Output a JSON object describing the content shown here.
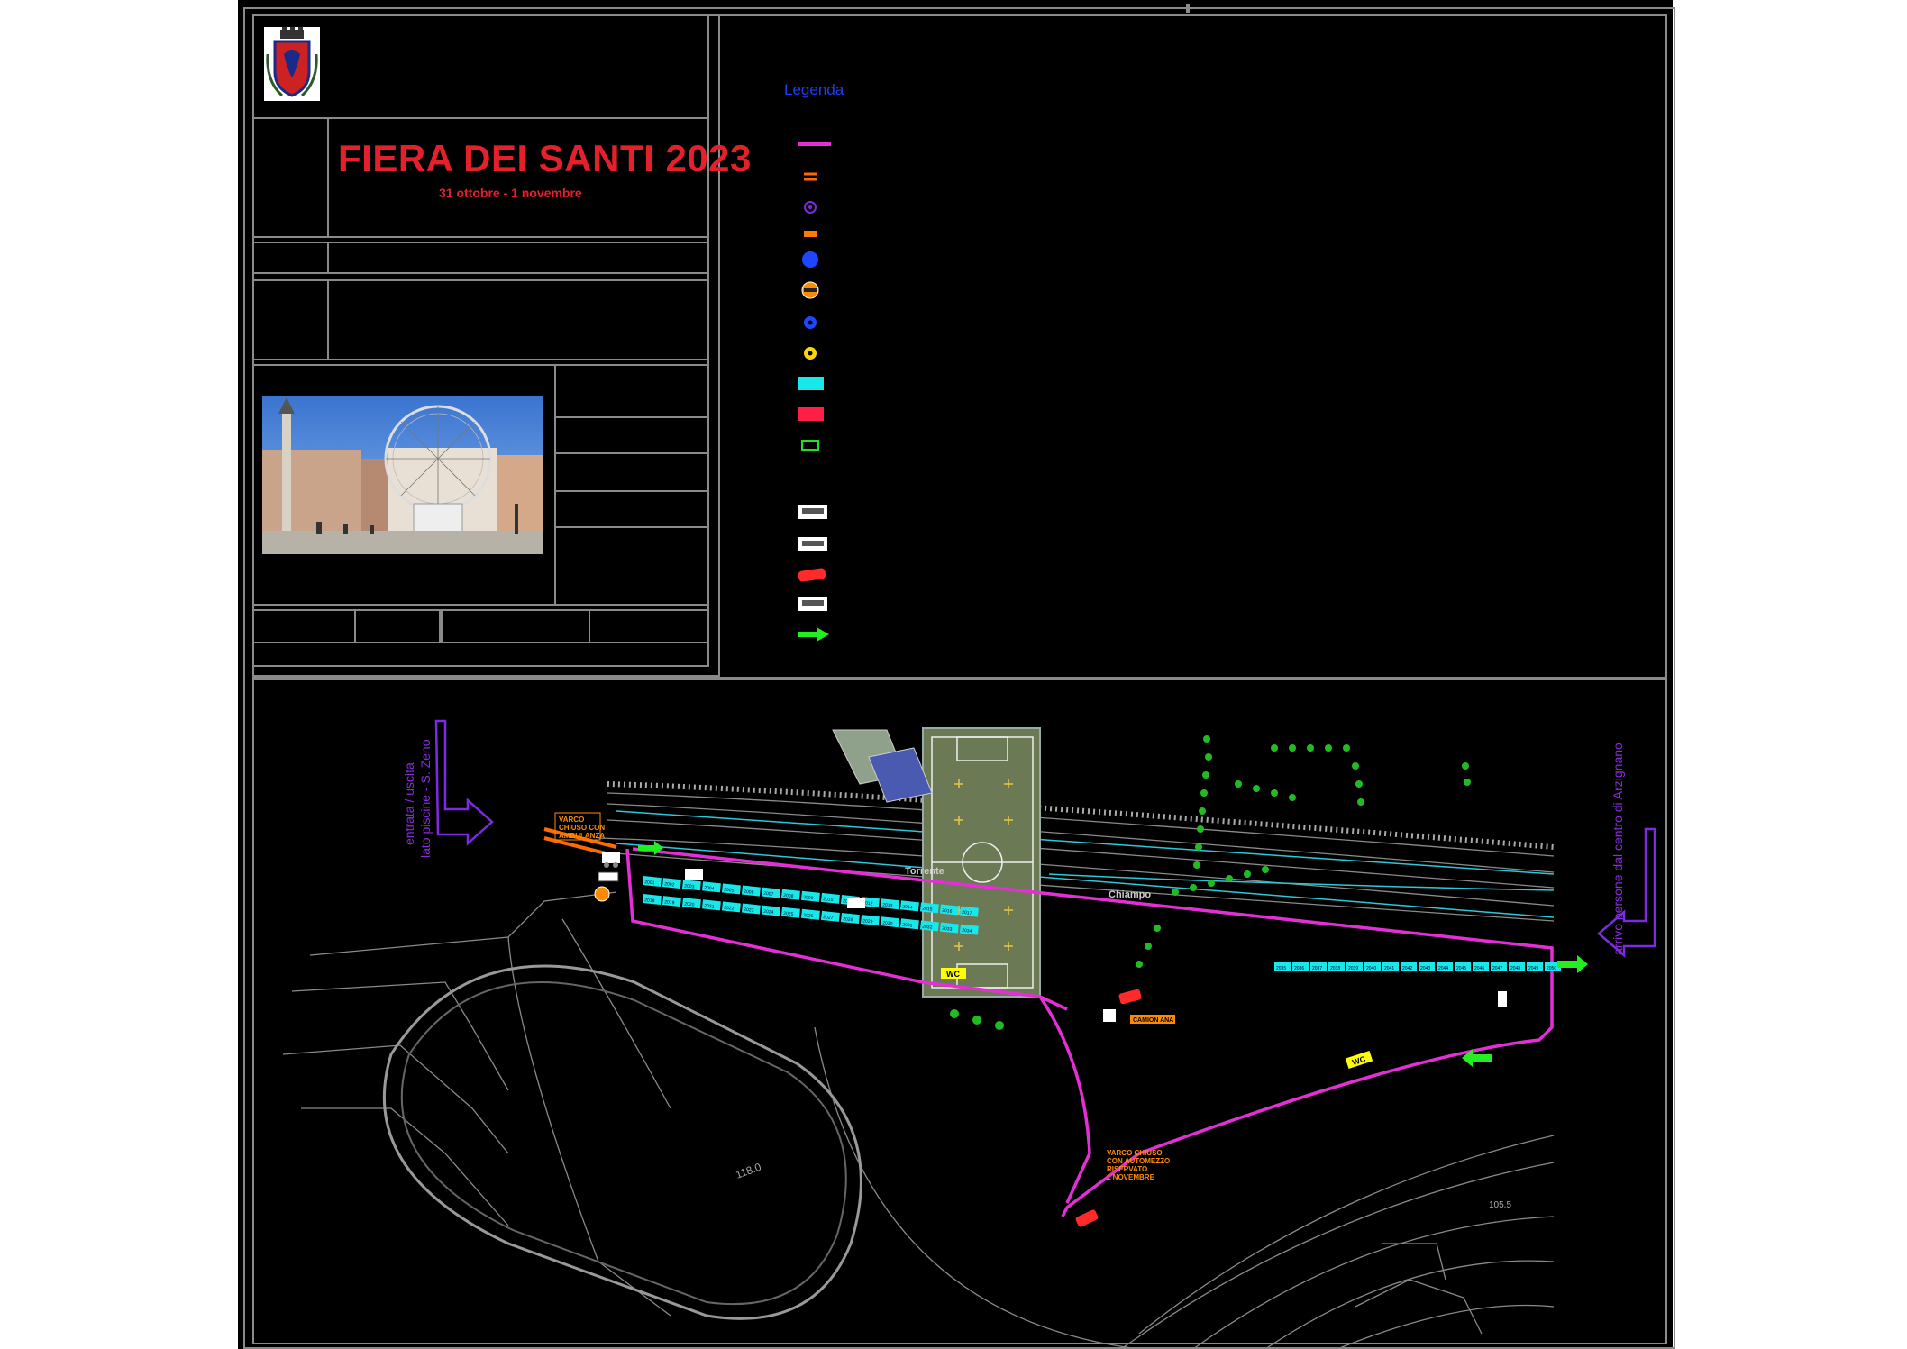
{
  "title": "FIERA DEI SANTI 2023",
  "subtitle": "31 ottobre  - 1 novembre",
  "legend": {
    "title": "Legenda",
    "symbols": [
      {
        "name": "percorso",
        "color": "#e52fd6",
        "shape": "line"
      },
      {
        "name": "transenne",
        "color": "#ff6a00",
        "shape": "double-dash"
      },
      {
        "name": "punto-viola",
        "color": "#7c2be2",
        "shape": "circle-small"
      },
      {
        "name": "segnale-arancio",
        "color": "#ff7a00",
        "shape": "small-rect"
      },
      {
        "name": "punto-blu-grande",
        "color": "#1e46ff",
        "shape": "circle-large"
      },
      {
        "name": "punto-arancio",
        "color": "#ff8a00",
        "shape": "circle-outline"
      },
      {
        "name": "punto-blu",
        "color": "#1e46ff",
        "shape": "circle-ring"
      },
      {
        "name": "punto-giallo",
        "color": "#ffd400",
        "shape": "circle-ring"
      },
      {
        "name": "banco-ciano",
        "color": "#18e8ea",
        "shape": "rect"
      },
      {
        "name": "banco-rosso",
        "color": "#ff1e46",
        "shape": "rect"
      },
      {
        "name": "wc-verde",
        "color": "#22dd22",
        "shape": "outline-rect"
      },
      {
        "name": "stand-bianco",
        "color": "#ffffff",
        "shape": "icon"
      },
      {
        "name": "stand-vuoto",
        "color": "#ffffff",
        "shape": "icon"
      },
      {
        "name": "camion-rosso",
        "color": "#ff2a2a",
        "shape": "vehicle"
      },
      {
        "name": "bus",
        "color": "#ffffff",
        "shape": "icon"
      },
      {
        "name": "freccia-verde",
        "color": "#22ee22",
        "shape": "arrow"
      }
    ]
  },
  "labels": {
    "entrance_left_1": "entrata / uscita",
    "entrance_left_2": "lato piscine - S. Zeno",
    "arrival_right": "arrivo persone dal centro di Arzignano",
    "road_torrente": "Torrente",
    "road_chiampo": "Chiampo",
    "wc_1": "WC",
    "wc_2": "WC",
    "closed_gate_1_l1": "VARCO",
    "closed_gate_1_l2": "CHIUSO CON",
    "closed_gate_1_l3": "AMBULANZA",
    "closed_gate_2_l1": "VARCO CHIUSO",
    "closed_gate_2_l2": "CON AUTOMEZZO",
    "closed_gate_2_l3": "RISERVATO",
    "closed_gate_2_l4": "1 NOVEMBRE",
    "camion_label": "CAMION ANA",
    "track_label": "118.0",
    "elev_label": "105.5"
  },
  "stalls_top": [
    "2001",
    "2002",
    "2003",
    "2004",
    "2005",
    "2006",
    "2007",
    "2008",
    "2009",
    "2010",
    "2011",
    "2012",
    "2013",
    "2014",
    "2015",
    "2016",
    "2017",
    "2018",
    "2019",
    "2020",
    "2021",
    "2022",
    "2023",
    "2024",
    "2025",
    "2026",
    "2027",
    "2028",
    "2029",
    "2030",
    "2031",
    "2032",
    "2033",
    "2034"
  ],
  "stalls_right": [
    "2035",
    "2036",
    "2037",
    "2038",
    "2039",
    "2040",
    "2041",
    "2042",
    "2043",
    "2044",
    "2045",
    "2046",
    "2047",
    "2048",
    "2049",
    "2050"
  ],
  "colors": {
    "route": "#e52fd6",
    "stall": "#18e8ea",
    "barrier": "#ff6a00",
    "arrow_purple": "#7c2be2",
    "green": "#22ee22",
    "field": "#6b7a55",
    "cad_line": "#8a8a8a",
    "title_red": "#e4202a"
  }
}
